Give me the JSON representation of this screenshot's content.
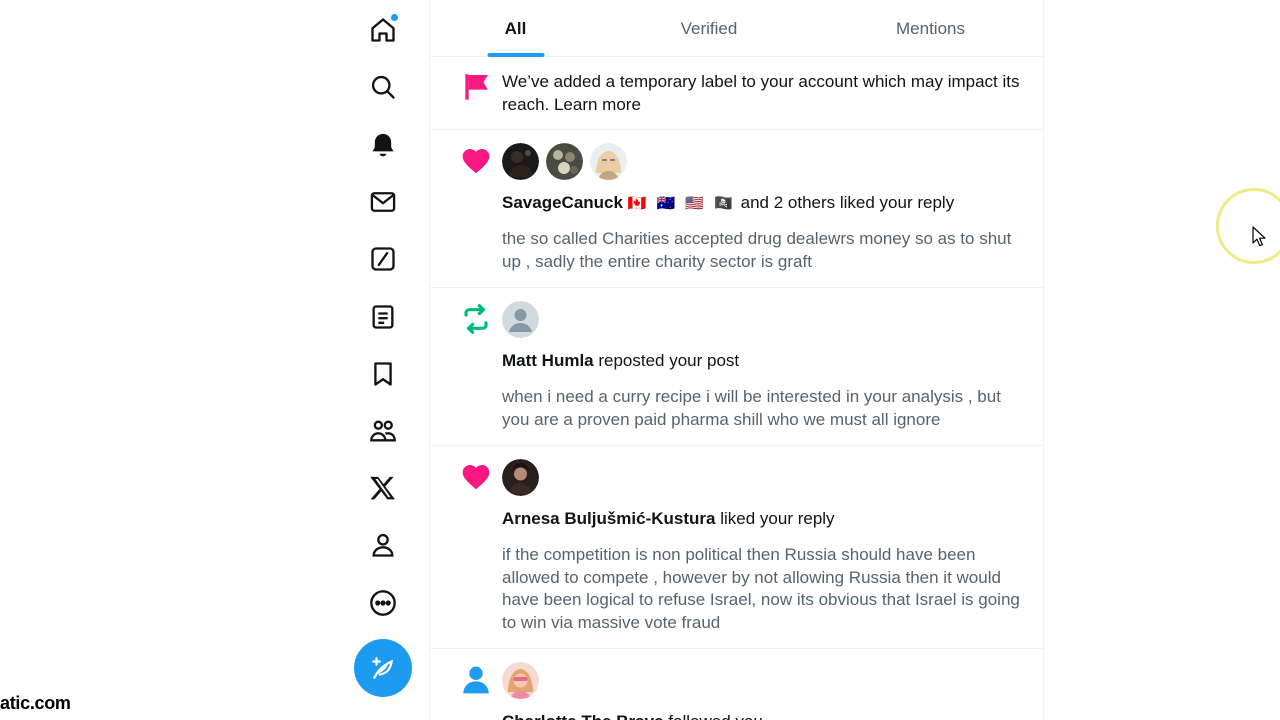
{
  "nav": {
    "items": [
      "home-icon",
      "search-icon",
      "bell-icon",
      "mail-icon",
      "grok-icon",
      "lists-icon",
      "bookmark-icon",
      "communities-icon",
      "x-logo-icon",
      "profile-icon",
      "more-icon"
    ],
    "compose_icon": "feather-plus-icon",
    "accent": "#1d9bf0"
  },
  "tabs": [
    {
      "label": "All",
      "active": true
    },
    {
      "label": "Verified",
      "active": false
    },
    {
      "label": "Mentions",
      "active": false
    }
  ],
  "notifications": [
    {
      "type": "label",
      "icon": "flag-icon",
      "text": "We’ve added a temporary label to your account which may impact its reach. Learn more"
    },
    {
      "type": "like",
      "icon": "heart-icon",
      "user": "SavageCanuck",
      "flags": "🇨🇦 🇦🇺 🇺🇸 🏴‍☠️",
      "action": " and 2 others liked your reply",
      "snippet": "the so called Charities accepted drug dealewrs money so as to shut up , sadly the entire charity sector is graft"
    },
    {
      "type": "repost",
      "icon": "repost-icon",
      "user": "Matt Humla",
      "action": " reposted your post",
      "snippet": "when i need a curry recipe i will be interested in your analysis , but you are a proven paid pharma shill who we must all ignore"
    },
    {
      "type": "like",
      "icon": "heart-icon",
      "user": "Arnesa Buljušmić-Kustura",
      "action": " liked your reply",
      "snippet": "if the competition is non political then Russia should have been allowed to compete , however by not allowing Russia then it would have been logical to refuse Israel, now its obvious that Israel is going to win via massive vote fraud"
    },
    {
      "type": "follow",
      "icon": "person-icon",
      "user": "Charlotte The Brave",
      "action": " followed you"
    }
  ],
  "colors": {
    "heart": "#f91880",
    "repost": "#00ba7c",
    "flag": "#f91880",
    "follow": "#1d9bf0"
  },
  "watermark": "atic.com"
}
